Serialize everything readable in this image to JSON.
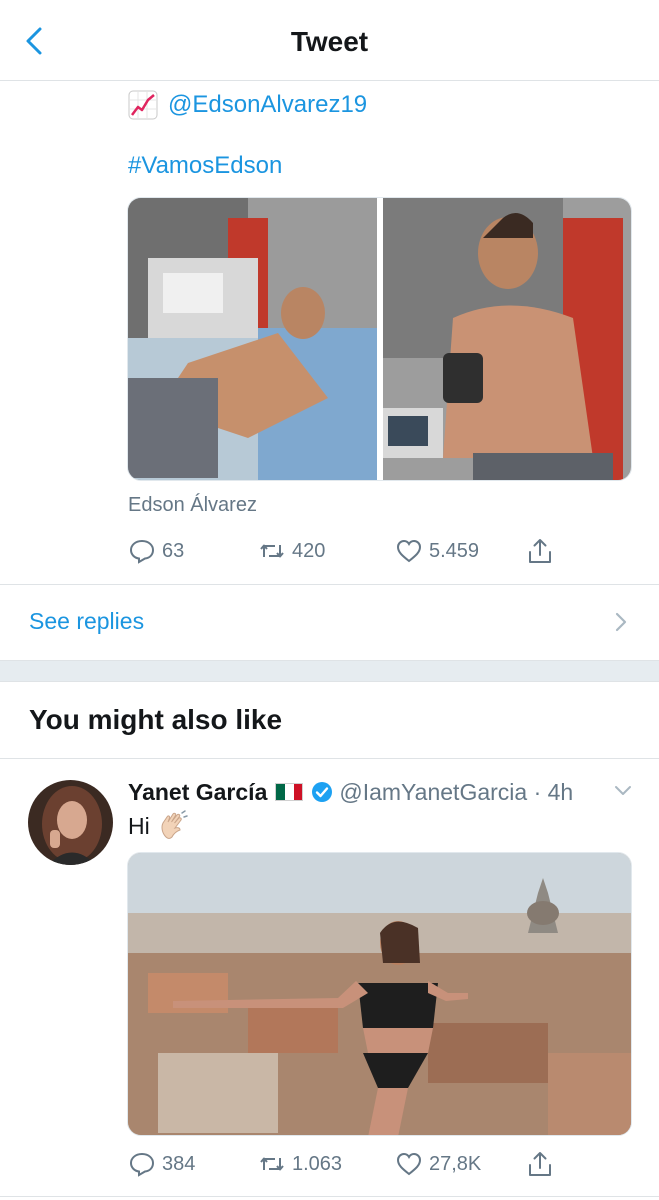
{
  "header": {
    "title": "Tweet"
  },
  "tweet": {
    "mention": "@EdsonAlvarez19",
    "hashtag": "#VamosEdson",
    "author_credit": "Edson Álvarez",
    "replies": "63",
    "retweets": "420",
    "likes": "5.459"
  },
  "see_replies": {
    "label": "See replies"
  },
  "suggestions": {
    "title": "You might also like",
    "tweet": {
      "display_name": "Yanet García",
      "handle": "@IamYanetGarcia · 4h",
      "text": "Hi",
      "replies": "384",
      "retweets": "1.063",
      "likes": "27,8K"
    }
  },
  "icons": {
    "back": "chevron-left-icon",
    "chart": "chart-increasing-emoji",
    "reply": "reply-icon",
    "retweet": "retweet-icon",
    "like": "heart-icon",
    "share": "share-icon",
    "chevron": "chevron-right-icon",
    "verified": "verified-badge-icon",
    "flag": "mexico-flag-emoji",
    "wave": "waving-hand-emoji",
    "caret": "chevron-down-icon"
  },
  "colors": {
    "accent": "#1b95e0",
    "muted": "#657786",
    "divider": "#dfe3e6",
    "band": "#e6ecf0",
    "text": "#14171a"
  }
}
